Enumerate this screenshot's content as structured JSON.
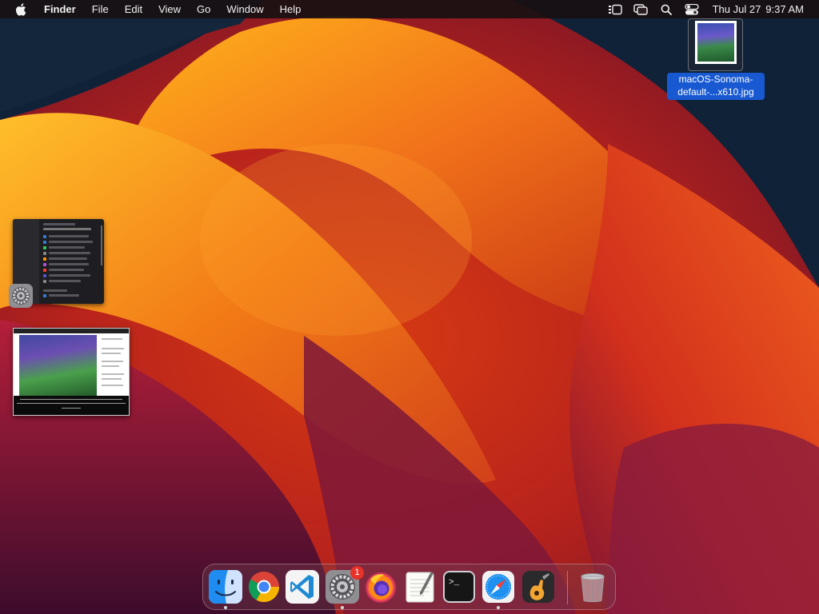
{
  "wallpaper": {
    "name": "macOS Ventura orange wallpaper",
    "colors": [
      "#0e2036",
      "#f5a615",
      "#e8521a",
      "#8a1a3c"
    ]
  },
  "menubar": {
    "apple_icon": "apple-logo-icon",
    "app_name": "Finder",
    "menus": [
      "File",
      "Edit",
      "View",
      "Go",
      "Window",
      "Help"
    ],
    "status_icons": [
      "stage-manager-icon",
      "screen-mirroring-icon",
      "spotlight-search-icon",
      "control-center-icon"
    ],
    "date": "Thu Jul 27",
    "time": "9:37 AM"
  },
  "desktop": {
    "file": {
      "name_line1": "macOS-Sonoma-",
      "name_line2": "default-...x610.jpg",
      "selected": true
    },
    "minimized_windows": [
      {
        "app": "System Settings",
        "icon": "system-settings-gear-icon"
      },
      {
        "app": "Preview",
        "content": "macOS Sonoma image page"
      }
    ]
  },
  "dock": {
    "apps": [
      {
        "name": "Finder",
        "icon": "finder-icon",
        "running": true
      },
      {
        "name": "Google Chrome",
        "icon": "chrome-icon",
        "running": false
      },
      {
        "name": "Visual Studio Code",
        "icon": "vscode-icon",
        "running": false
      },
      {
        "name": "System Settings",
        "icon": "settings-gear-icon",
        "running": true,
        "badge": "1"
      },
      {
        "name": "Firefox",
        "icon": "firefox-icon",
        "running": false
      },
      {
        "name": "TextEdit",
        "icon": "textedit-icon",
        "running": false
      },
      {
        "name": "Terminal",
        "icon": "terminal-icon",
        "running": false,
        "prompt": ">_"
      },
      {
        "name": "Safari",
        "icon": "safari-icon",
        "running": true
      },
      {
        "name": "GarageBand",
        "icon": "garageband-icon",
        "running": false
      }
    ],
    "trash": {
      "name": "Trash",
      "icon": "trash-icon"
    }
  }
}
